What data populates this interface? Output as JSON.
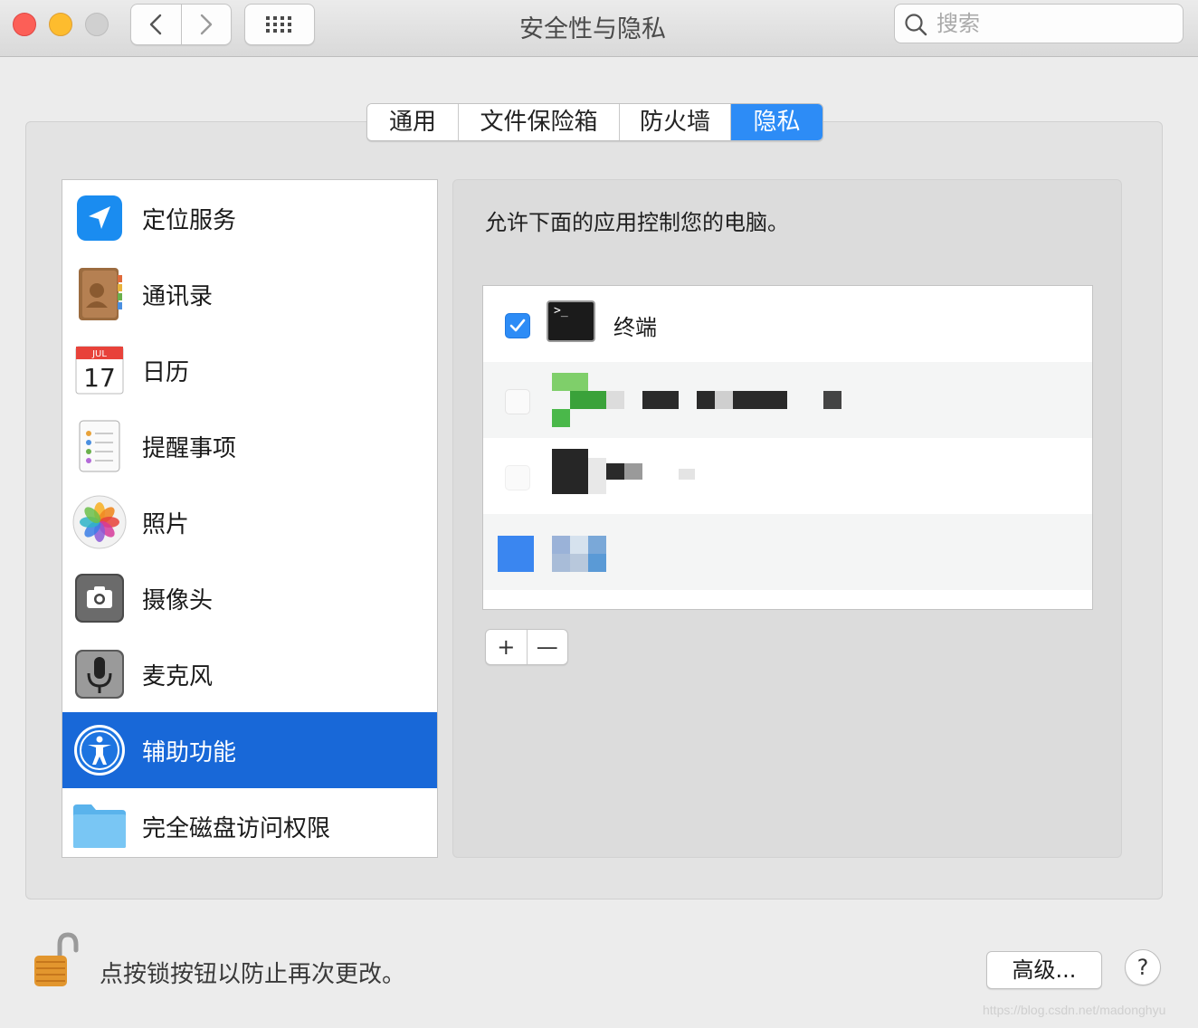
{
  "window": {
    "title": "安全性与隐私"
  },
  "search": {
    "placeholder": "搜索"
  },
  "tabs": [
    {
      "label": "通用"
    },
    {
      "label": "文件保险箱"
    },
    {
      "label": "防火墙"
    },
    {
      "label": "隐私",
      "selected": true
    }
  ],
  "sidebar": {
    "items": [
      {
        "label": "定位服务",
        "icon": "location-icon"
      },
      {
        "label": "通讯录",
        "icon": "contacts-icon"
      },
      {
        "label": "日历",
        "icon": "calendar-icon",
        "icon_month": "JUL",
        "icon_day": "17"
      },
      {
        "label": "提醒事项",
        "icon": "reminders-icon"
      },
      {
        "label": "照片",
        "icon": "photos-icon"
      },
      {
        "label": "摄像头",
        "icon": "camera-icon"
      },
      {
        "label": "麦克风",
        "icon": "microphone-icon"
      },
      {
        "label": "辅助功能",
        "icon": "accessibility-icon",
        "selected": true
      },
      {
        "label": "完全磁盘访问权限",
        "icon": "folder-icon"
      }
    ]
  },
  "main": {
    "description": "允许下面的应用控制您的电脑。",
    "apps": [
      {
        "name": "终端",
        "checked": true,
        "icon": "terminal-icon",
        "icon_text": ">_"
      },
      {
        "name": "",
        "checked": false,
        "icon": "pixelated-app-icon"
      },
      {
        "name": "",
        "checked": false,
        "icon": "pixelated-app-icon"
      },
      {
        "name": "",
        "checked": false,
        "icon": "pixelated-app-icon"
      }
    ],
    "add_label": "+",
    "remove_label": "—"
  },
  "footer": {
    "lock_text": "点按锁按钮以防止再次更改。",
    "advanced_label": "高级...",
    "help_label": "?"
  },
  "watermark": "https://blog.csdn.net/madonghyu",
  "colors": {
    "accent": "#2d8cf6",
    "selection": "#1868d8"
  }
}
